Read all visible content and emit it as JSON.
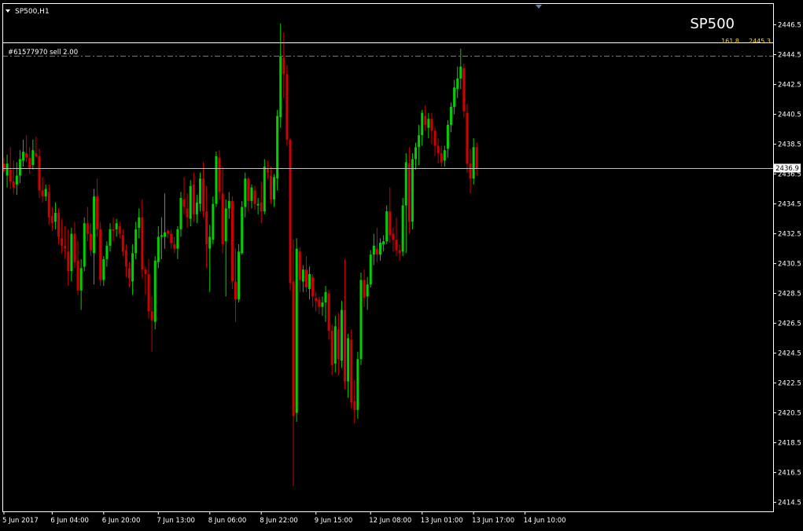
{
  "window": {
    "title": "SP500,H1",
    "symbol_watermark": "SP500"
  },
  "colors": {
    "background": "#000000",
    "foreground": "#FFFFFF",
    "bull": "#00D000",
    "bear": "#D00000",
    "doji": "#FFFFFF",
    "trade_line": "#22B422",
    "fib_label": "#FFD700",
    "bid_line": "#C0C0C0",
    "fib_line": "#FFFFFF"
  },
  "annotations": {
    "order_label": "#61577970 sell 2.00",
    "order_price": 2444.45,
    "fib_level_label": "161.8",
    "fib_price_label": "2445.3",
    "fib_price": 2445.3,
    "current_price_label": "2436.9",
    "current_price": 2436.9
  },
  "chart_data": {
    "type": "candlestick",
    "title": "SP500,H1",
    "ylim": [
      2413.9,
      2447.9
    ],
    "y_ticks": [
      2446.5,
      2444.5,
      2442.5,
      2440.5,
      2438.5,
      2436.5,
      2434.5,
      2432.5,
      2430.5,
      2428.5,
      2426.5,
      2424.5,
      2422.5,
      2420.5,
      2418.5,
      2416.5,
      2414.5
    ],
    "x_labels": [
      "5 Jun 2017",
      "6 Jun 04:00",
      "6 Jun 20:00",
      "7 Jun 13:00",
      "8 Jun 06:00",
      "8 Jun 22:00",
      "9 Jun 15:00",
      "12 Jun 08:00",
      "13 Jun 01:00",
      "13 Jun 17:00",
      "14 Jun 10:00"
    ],
    "x_label_bar_index": [
      0,
      15,
      31,
      48,
      64,
      80,
      97,
      114,
      130,
      146,
      162
    ],
    "grid": false,
    "candles": [
      [
        2437.2,
        2437.6,
        2436.6,
        2436.7
      ],
      [
        2436.4,
        2437.8,
        2435.6,
        2437.2
      ],
      [
        2436.8,
        2438.3,
        2435.5,
        2436.0
      ],
      [
        2436.0,
        2437.4,
        2435.2,
        2435.6
      ],
      [
        2435.8,
        2437.3,
        2435.1,
        2436.4
      ],
      [
        2436.4,
        2438.1,
        2435.9,
        2437.5
      ],
      [
        2437.4,
        2438.8,
        2437.0,
        2438.0
      ],
      [
        2437.9,
        2439.1,
        2437.3,
        2437.6
      ],
      [
        2437.6,
        2438.3,
        2436.5,
        2436.9
      ],
      [
        2437.1,
        2438.8,
        2436.8,
        2438.1
      ],
      [
        2437.9,
        2439.0,
        2437.6,
        2437.7
      ],
      [
        2437.7,
        2438.2,
        2434.9,
        2435.4
      ],
      [
        2435.4,
        2436.3,
        2434.6,
        2435.0
      ],
      [
        2435.0,
        2435.8,
        2434.7,
        2435.5
      ],
      [
        2435.3,
        2435.8,
        2433.1,
        2433.6
      ],
      [
        2433.7,
        2434.3,
        2432.7,
        2433.2
      ],
      [
        2433.3,
        2434.6,
        2432.8,
        2433.9
      ],
      [
        2433.9,
        2434.2,
        2431.8,
        2432.3
      ],
      [
        2432.2,
        2433.5,
        2431.2,
        2431.7
      ],
      [
        2431.7,
        2433.0,
        2430.8,
        2431.5
      ],
      [
        2431.3,
        2432.8,
        2429.0,
        2430.0
      ],
      [
        2430.0,
        2432.9,
        2429.3,
        2432.5
      ],
      [
        2432.5,
        2433.3,
        2430.2,
        2430.6
      ],
      [
        2430.7,
        2432.0,
        2428.4,
        2428.7
      ],
      [
        2428.7,
        2430.8,
        2427.4,
        2430.2
      ],
      [
        2430.3,
        2433.6,
        2430.0,
        2433.2
      ],
      [
        2433.2,
        2434.3,
        2432.0,
        2432.5
      ],
      [
        2432.5,
        2433.2,
        2431.0,
        2431.4
      ],
      [
        2431.2,
        2435.5,
        2429.1,
        2435.0
      ],
      [
        2435.0,
        2436.2,
        2432.3,
        2432.8
      ],
      [
        2432.8,
        2433.3,
        2429.0,
        2429.4
      ],
      [
        2429.4,
        2431.0,
        2429.0,
        2430.8
      ],
      [
        2430.8,
        2432.0,
        2430.3,
        2431.7
      ],
      [
        2431.7,
        2433.2,
        2431.3,
        2432.8
      ],
      [
        2432.8,
        2433.6,
        2432.0,
        2432.7
      ],
      [
        2432.8,
        2433.5,
        2432.3,
        2433.2
      ],
      [
        2433.0,
        2433.3,
        2432.2,
        2432.5
      ],
      [
        2432.4,
        2432.8,
        2431.0,
        2431.3
      ],
      [
        2431.4,
        2431.8,
        2429.6,
        2430.3
      ],
      [
        2430.2,
        2430.6,
        2428.9,
        2429.5
      ],
      [
        2429.3,
        2431.8,
        2428.4,
        2431.2
      ],
      [
        2431.2,
        2433.3,
        2430.8,
        2432.8
      ],
      [
        2432.9,
        2434.2,
        2432.2,
        2433.6
      ],
      [
        2433.6,
        2434.8,
        2429.5,
        2430.1
      ],
      [
        2430.1,
        2430.3,
        2428.4,
        2429.8
      ],
      [
        2429.8,
        2430.8,
        2426.8,
        2427.3
      ],
      [
        2427.3,
        2428.3,
        2424.6,
        2426.7
      ],
      [
        2426.6,
        2431.0,
        2426.1,
        2430.7
      ],
      [
        2430.6,
        2433.0,
        2430.2,
        2432.3
      ],
      [
        2432.3,
        2433.6,
        2430.8,
        2432.4
      ],
      [
        2432.3,
        2435.2,
        2431.5,
        2432.6
      ],
      [
        2432.7,
        2432.8,
        2432.2,
        2432.5
      ],
      [
        2432.5,
        2432.8,
        2431.5,
        2431.9
      ],
      [
        2431.8,
        2432.3,
        2431.2,
        2431.5
      ],
      [
        2431.5,
        2433.0,
        2430.8,
        2432.8
      ],
      [
        2432.8,
        2435.3,
        2432.3,
        2434.9
      ],
      [
        2434.8,
        2436.3,
        2433.8,
        2434.3
      ],
      [
        2434.2,
        2435.2,
        2432.9,
        2433.6
      ],
      [
        2433.5,
        2436.1,
        2433.0,
        2435.7
      ],
      [
        2435.8,
        2436.6,
        2433.3,
        2433.8
      ],
      [
        2433.8,
        2435.1,
        2433.2,
        2434.6
      ],
      [
        2434.5,
        2436.6,
        2434.0,
        2436.2
      ],
      [
        2436.2,
        2437.3,
        2433.6,
        2434.0
      ],
      [
        2434.0,
        2435.7,
        2430.2,
        2431.8
      ],
      [
        2431.5,
        2433.1,
        2428.6,
        2432.3
      ],
      [
        2432.1,
        2435.0,
        2431.8,
        2434.5
      ],
      [
        2434.5,
        2438.0,
        2434.3,
        2437.7
      ],
      [
        2437.6,
        2438.1,
        2434.8,
        2435.3
      ],
      [
        2435.2,
        2437.0,
        2431.2,
        2431.8
      ],
      [
        2432.0,
        2434.8,
        2428.3,
        2434.2
      ],
      [
        2434.2,
        2435.3,
        2433.5,
        2434.7
      ],
      [
        2434.7,
        2435.0,
        2428.8,
        2429.3
      ],
      [
        2429.3,
        2431.5,
        2426.6,
        2428.1
      ],
      [
        2428.1,
        2431.8,
        2427.9,
        2431.3
      ],
      [
        2431.2,
        2434.7,
        2431.1,
        2434.3
      ],
      [
        2434.3,
        2436.6,
        2433.6,
        2436.2
      ],
      [
        2436.2,
        2436.3,
        2434.0,
        2434.7
      ],
      [
        2434.7,
        2435.8,
        2434.2,
        2435.6
      ],
      [
        2435.4,
        2435.7,
        2434.1,
        2434.5
      ],
      [
        2434.4,
        2434.9,
        2433.8,
        2434.5
      ],
      [
        2434.6,
        2436.0,
        2433.2,
        2434.0
      ],
      [
        2434.0,
        2437.5,
        2433.8,
        2437.0
      ],
      [
        2436.9,
        2437.4,
        2436.2,
        2436.6
      ],
      [
        2436.4,
        2437.0,
        2434.5,
        2434.8
      ],
      [
        2434.8,
        2436.5,
        2434.3,
        2436.3
      ],
      [
        2436.2,
        2440.8,
        2435.4,
        2440.4
      ],
      [
        2440.3,
        2446.6,
        2439.6,
        2444.4
      ],
      [
        2444.3,
        2446.0,
        2441.6,
        2443.2
      ],
      [
        2443.2,
        2443.8,
        2438.4,
        2438.8
      ],
      [
        2438.8,
        2438.9,
        2428.7,
        2429.2
      ],
      [
        2429.3,
        2432.1,
        2415.6,
        2420.3
      ],
      [
        2420.5,
        2432.2,
        2419.9,
        2431.5
      ],
      [
        2431.3,
        2431.6,
        2428.6,
        2429.4
      ],
      [
        2429.3,
        2430.4,
        2428.6,
        2430.1
      ],
      [
        2430.1,
        2431.0,
        2428.6,
        2428.9
      ],
      [
        2428.8,
        2430.3,
        2428.1,
        2429.8
      ],
      [
        2429.6,
        2429.8,
        2427.6,
        2428.3
      ],
      [
        2428.2,
        2428.6,
        2427.3,
        2428.0
      ],
      [
        2428.1,
        2428.3,
        2427.1,
        2427.6
      ],
      [
        2427.6,
        2428.3,
        2427.0,
        2427.9
      ],
      [
        2427.9,
        2429.0,
        2426.6,
        2428.6
      ],
      [
        2428.5,
        2428.7,
        2425.4,
        2426.0
      ],
      [
        2426.0,
        2426.4,
        2423.0,
        2423.7
      ],
      [
        2423.8,
        2427.0,
        2423.2,
        2426.3
      ],
      [
        2426.1,
        2427.2,
        2423.0,
        2424.1
      ],
      [
        2424.0,
        2428.0,
        2423.5,
        2427.4
      ],
      [
        2427.4,
        2430.8,
        2422.1,
        2422.6
      ],
      [
        2422.6,
        2425.8,
        2421.5,
        2425.5
      ],
      [
        2425.4,
        2426.1,
        2420.8,
        2421.2
      ],
      [
        2421.3,
        2422.7,
        2419.8,
        2420.7
      ],
      [
        2420.7,
        2424.6,
        2420.1,
        2424.1
      ],
      [
        2424.1,
        2429.9,
        2423.7,
        2429.4
      ],
      [
        2429.4,
        2430.1,
        2427.6,
        2428.2
      ],
      [
        2428.3,
        2429.6,
        2427.4,
        2429.1
      ],
      [
        2429.1,
        2431.4,
        2428.9,
        2431.1
      ],
      [
        2431.1,
        2432.5,
        2430.4,
        2431.7
      ],
      [
        2431.5,
        2432.9,
        2430.6,
        2431.1
      ],
      [
        2431.1,
        2432.2,
        2430.7,
        2431.9
      ],
      [
        2431.8,
        2432.4,
        2431.3,
        2432.0
      ],
      [
        2432.0,
        2434.4,
        2431.8,
        2434.0
      ],
      [
        2434.0,
        2435.6,
        2431.9,
        2432.4
      ],
      [
        2432.5,
        2432.9,
        2431.3,
        2432.1
      ],
      [
        2432.1,
        2433.6,
        2431.0,
        2431.4
      ],
      [
        2431.4,
        2431.8,
        2430.7,
        2431.2
      ],
      [
        2431.3,
        2434.9,
        2431.0,
        2434.4
      ],
      [
        2434.4,
        2437.9,
        2431.2,
        2437.3
      ],
      [
        2437.2,
        2438.3,
        2432.5,
        2433.3
      ],
      [
        2433.3,
        2437.9,
        2432.8,
        2437.5
      ],
      [
        2437.5,
        2438.6,
        2436.8,
        2438.3
      ],
      [
        2438.3,
        2439.8,
        2437.1,
        2439.1
      ],
      [
        2439.1,
        2440.8,
        2438.4,
        2440.6
      ],
      [
        2440.4,
        2441.1,
        2439.4,
        2439.8
      ],
      [
        2439.6,
        2440.6,
        2438.9,
        2440.2
      ],
      [
        2440.2,
        2440.6,
        2438.5,
        2439.4
      ],
      [
        2439.4,
        2439.6,
        2437.7,
        2438.4
      ],
      [
        2438.4,
        2438.9,
        2437.2,
        2437.9
      ],
      [
        2437.9,
        2438.4,
        2437.0,
        2437.3
      ],
      [
        2437.4,
        2438.4,
        2437.0,
        2438.1
      ],
      [
        2438.2,
        2440.1,
        2437.6,
        2439.8
      ],
      [
        2439.8,
        2441.3,
        2439.3,
        2441.0
      ],
      [
        2441.0,
        2442.8,
        2440.5,
        2442.3
      ],
      [
        2442.2,
        2443.7,
        2441.6,
        2442.9
      ],
      [
        2442.9,
        2444.9,
        2442.2,
        2443.7
      ],
      [
        2443.6,
        2443.9,
        2440.3,
        2440.7
      ],
      [
        2440.6,
        2441.2,
        2436.6,
        2437.2
      ],
      [
        2437.2,
        2438.2,
        2435.2,
        2436.2
      ],
      [
        2436.2,
        2438.9,
        2435.8,
        2438.3
      ],
      [
        2438.3,
        2438.6,
        2436.4,
        2436.9
      ]
    ]
  }
}
